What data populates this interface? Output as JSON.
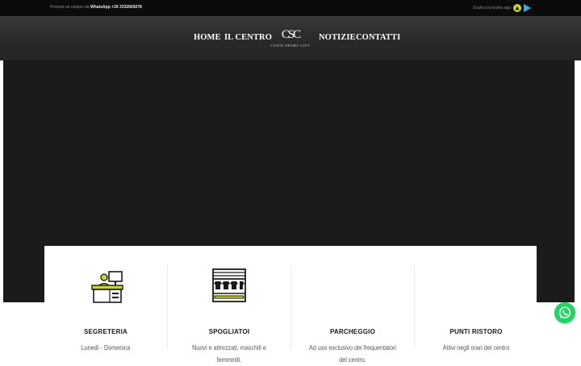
{
  "topbar": {
    "booking_text": "Prenota un campo via",
    "booking_channel": "WhatsApp",
    "booking_phone": "+39 3332669278",
    "app_text": "Scarica la nostra app"
  },
  "nav": {
    "home": "HOME",
    "center": "IL CENTRO",
    "news": "NOTIZIE",
    "contacts": "CONTATTI"
  },
  "logo": {
    "monogram": "CSC",
    "name": "CONTI SPORT CITY"
  },
  "features": [
    {
      "title": "SEGRETERIA",
      "desc": "Lunedì - Domenica",
      "icon": "reception-desk-icon"
    },
    {
      "title": "SPOGLIATOI",
      "desc": "Nuovi e attrezzati, maschili e femminili.",
      "icon": "locker-room-icon"
    },
    {
      "title": "PARCHEGGIO",
      "desc": "Ad uso esclusivo dei frequentatori del centro.",
      "icon": "parking-icon"
    },
    {
      "title": "PUNTI RISTORO",
      "desc": "Attivi negli orari del centro",
      "icon": "refreshment-icon"
    }
  ],
  "colors": {
    "topbar": "#0b0b0b",
    "header": "#2b2b2b",
    "hero": "#1b1b1b",
    "whatsapp": "#25d366",
    "app_store": "#c7d72a",
    "play_store": "#2bb3e8"
  }
}
